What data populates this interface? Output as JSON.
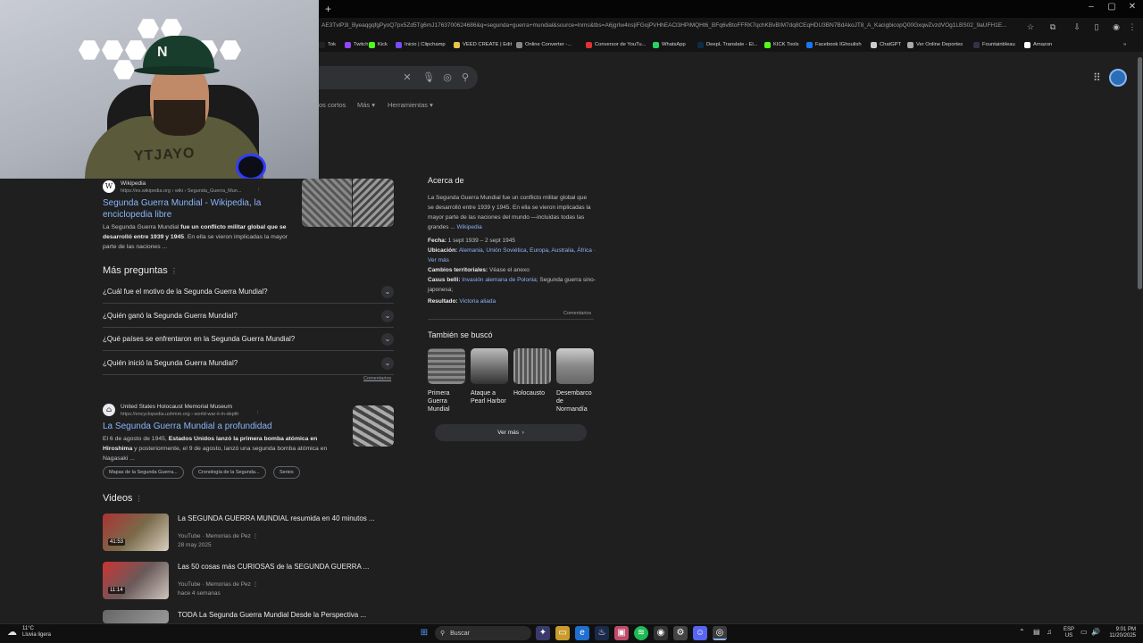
{
  "browser": {
    "new_tab_symbol": "+",
    "url": "AE3TvlP3l_ByeaqgqfgPyoQ7px5Zd5Tg6mJ1763700624686&q=segunda+guerra+mundial&source=lnms&tbs=A6jgrIw4ns|iFGojPVHhEACl3HPiMQHt6_BFq6vBtoFFRK7qchKBvBIM7dq8CEqHDU3BN7BdAkoJT8_A_KacigbicopQ00GxqwZvzdVOg1LBS02_9aUFH1E...",
    "window_controls": [
      "–",
      "▢",
      "✕"
    ],
    "bookmarks": [
      {
        "label": "Tok",
        "color": "#222"
      },
      {
        "label": "Twitch",
        "color": "#9146ff"
      },
      {
        "label": "Kick",
        "color": "#53fc18"
      },
      {
        "label": "Inicio | Clipchamp",
        "color": "#7a4bff"
      },
      {
        "label": "VEED CREATE | Edit",
        "color": "#e8c547"
      },
      {
        "label": "Online Converter -...",
        "color": "#888"
      },
      {
        "label": "Conversor de YouTu...",
        "color": "#d33"
      },
      {
        "label": "WhatsApp",
        "color": "#25d366"
      },
      {
        "label": "DeepL Translate - El...",
        "color": "#0f2b46"
      },
      {
        "label": "KICK Tools",
        "color": "#53fc18"
      },
      {
        "label": "Facebook IGhoulish",
        "color": "#1877f2"
      },
      {
        "label": "ChatGPT",
        "color": "#ccc"
      },
      {
        "label": "Ver Online Deportes",
        "color": "#aaa"
      },
      {
        "label": "Fountainbleau",
        "color": "#334"
      },
      {
        "label": "Amazon",
        "color": "#fff"
      }
    ]
  },
  "google": {
    "nav": [
      "os cortos",
      "Más",
      "Herramientas"
    ]
  },
  "webcam": {
    "cap_logo": "N",
    "shirt_text": "YTJAYO"
  },
  "results": {
    "wiki": {
      "site": "Wikipedia",
      "url": "https://es.wikipedia.org › wiki › Segunda_Guerra_Mun...",
      "title": "Segunda Guerra Mundial - Wikipedia, la enciclopedia libre",
      "snippet_pre": "La Segunda Guerra Mundial ",
      "snippet_bold": "fue un conflicto militar global que se desarrolló entre 1939 y 1945",
      "snippet_post": ". En ella se vieron implicadas la mayor parte de las naciones ..."
    },
    "paa": {
      "heading": "Más preguntas",
      "questions": [
        "¿Cuál fue el motivo de la Segunda Guerra Mundial?",
        "¿Quién ganó la Segunda Guerra Mundial?",
        "¿Qué países se enfrentaron en la Segunda Guerra Mundial?",
        "¿Quién inició la Segunda Guerra Mundial?"
      ],
      "feedback": "Comentarios"
    },
    "ushmm": {
      "site": "United States Holocaust Memorial Museum",
      "url": "https://encyclopedia.ushmm.org › world-war-ii-in-depth",
      "title": "La Segunda Guerra Mundial a profundidad",
      "snippet_pre": "El 6 de agosto de 1945, ",
      "snippet_bold": "Estados Unidos lanzó la primera bomba atómica en Hiroshima",
      "snippet_post": " y posteriormente, el 9 de agosto, lanzó una segunda bomba atómica en Nagasaki ...",
      "chips": [
        "Mapas de la Segunda Guerra...",
        "Cronología de la Segunda...",
        "Series"
      ]
    },
    "videos": {
      "heading": "Videos",
      "items": [
        {
          "title": "La SEGUNDA GUERRA MUNDIAL resumida en 40 minutos ...",
          "source": "YouTube · Memorias de Pez",
          "date": "28 may 2025",
          "duration": "41:53"
        },
        {
          "title": "Las 50 cosas más CURIOSAS de la SEGUNDA GUERRA ...",
          "source": "YouTube · Memorias de Pez",
          "date": "hace 4 semanas",
          "duration": "11:14"
        },
        {
          "title": "TODA La Segunda Guerra Mundial Desde la Perspectiva ...",
          "source": "",
          "date": "",
          "duration": ""
        }
      ]
    }
  },
  "knowledge_panel": {
    "heading": "Acerca de",
    "description": "La Segunda Guerra Mundial fue un conflicto militar global que se desarrolló entre 1939 y 1945. En ella se vieron implicadas la mayor parte de las naciones del mundo —incluidas todas las grandes ...",
    "source_link": "Wikipedia",
    "fecha_label": "Fecha:",
    "fecha_value": "1 sept 1939 – 2 sept 1945",
    "ubicacion_label": "Ubicación:",
    "ubicacion_value": "Alemania, Unión Soviética, Europa, Australia, África",
    "ubicacion_more": "· Ver más",
    "cambios_label": "Cambios territoriales:",
    "cambios_value": "Véase el anexo",
    "casus_label": "Casus belli:",
    "casus_value": "Invasión alemana de Polonia",
    "casus_value2": "; Segunda guerra sino-japonesa;",
    "resultado_label": "Resultado:",
    "resultado_value": "Victoria aliada",
    "feedback": "Comentarios",
    "also_heading": "También se buscó",
    "also": [
      "Primera Guerra Mundial",
      "Ataque a Pearl Harbor",
      "Holocausto",
      "Desembarco de Normandía"
    ],
    "ver_mas": "Ver más"
  },
  "taskbar": {
    "weather_temp": "11°C",
    "weather_desc": "Lluvia ligera",
    "search_label": "Buscar",
    "lang": "ESP",
    "region": "US",
    "time": "9:01 PM",
    "date": "11/20/2025"
  }
}
